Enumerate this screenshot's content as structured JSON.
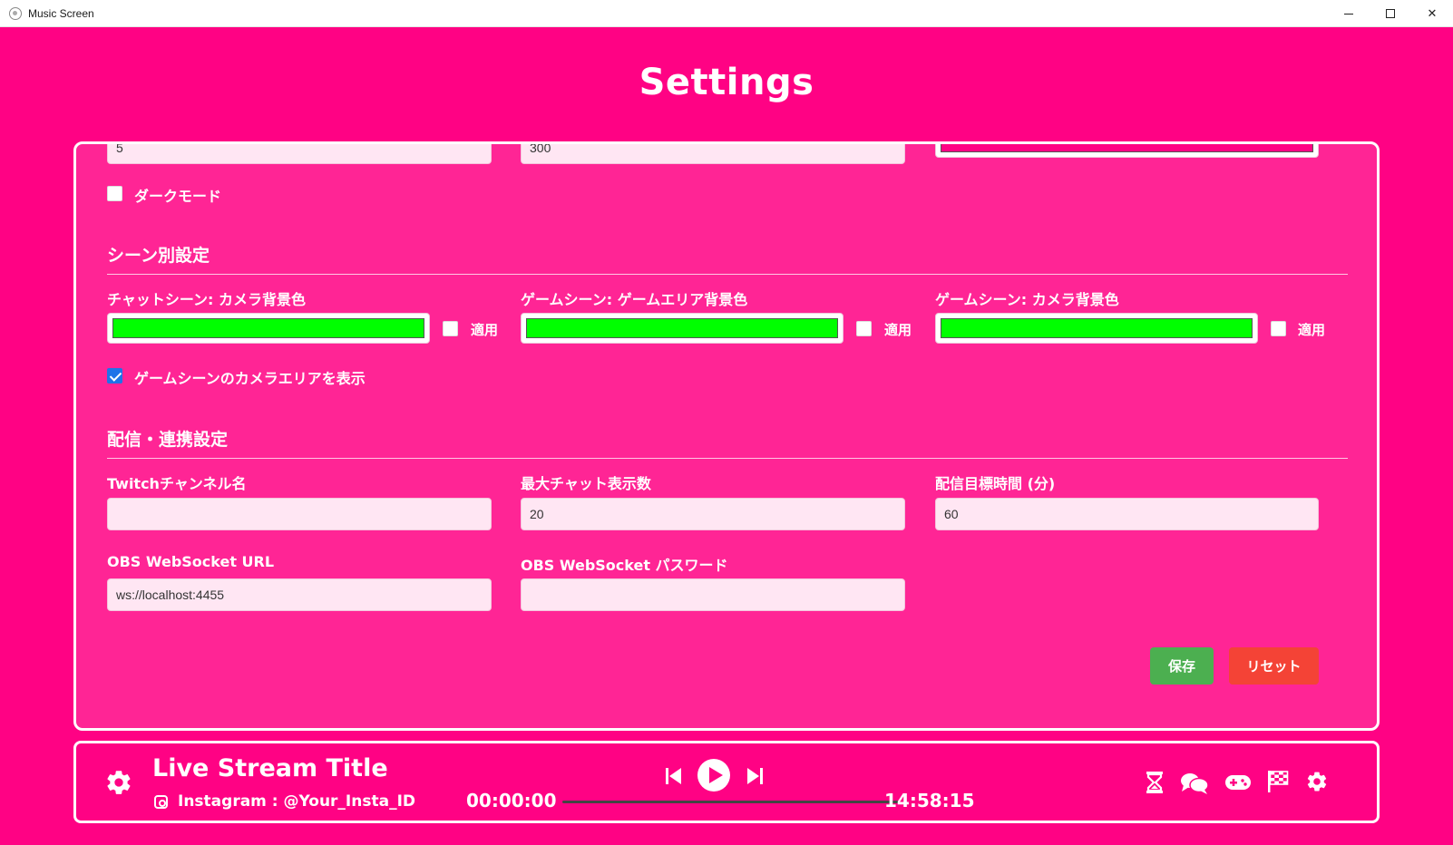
{
  "window": {
    "title": "Music Screen",
    "minimize_icon": "minimize-icon",
    "maximize_icon": "maximize-icon",
    "close_icon": "close-icon",
    "close_glyph": "✕"
  },
  "page": {
    "title": "Settings"
  },
  "top_row": {
    "input1_value": "5",
    "input2_value": "300"
  },
  "dark_mode": {
    "label": "ダークモード",
    "checked": false
  },
  "scene_section": {
    "title": "シーン別設定",
    "fields": [
      {
        "label": "チャットシーン: カメラ背景色",
        "color": "#00ff00",
        "apply_label": "適用",
        "applied": false
      },
      {
        "label": "ゲームシーン: ゲームエリア背景色",
        "color": "#00ff00",
        "apply_label": "適用",
        "applied": false
      },
      {
        "label": "ゲームシーン: カメラ背景色",
        "color": "#00ff00",
        "apply_label": "適用",
        "applied": false
      }
    ],
    "show_camera": {
      "label": "ゲームシーンのカメラエリアを表示",
      "checked": true
    }
  },
  "stream_section": {
    "title": "配信・連携設定",
    "twitch_label": "Twitchチャンネル名",
    "twitch_value": "",
    "max_chat_label": "最大チャット表示数",
    "max_chat_value": "20",
    "target_time_label": "配信目標時間 (分)",
    "target_time_value": "60",
    "obs_url_label": "OBS WebSocket URL",
    "obs_url_value": "ws://localhost:4455",
    "obs_pass_label": "OBS WebSocket パスワード",
    "obs_pass_value": ""
  },
  "buttons": {
    "save": "保存",
    "reset": "リセット"
  },
  "colors": {
    "background": "#ff0284",
    "panel": "#ff2595",
    "save_button": "#4caf50",
    "reset_button": "#f44336",
    "color_swatch": "#00ff00",
    "checkbox_checked": "#1f73e8"
  },
  "player": {
    "title": "Live Stream Title",
    "instagram": "Instagram : @Your_Insta_ID",
    "elapsed": "00:00:00",
    "remaining": "14:58:15",
    "progress": 0,
    "icons": [
      "settings-icon",
      "previous-icon",
      "play-icon",
      "next-icon",
      "hourglass-icon",
      "chat-icon",
      "gamepad-icon",
      "checkered-flag-icon",
      "settings-icon"
    ]
  }
}
